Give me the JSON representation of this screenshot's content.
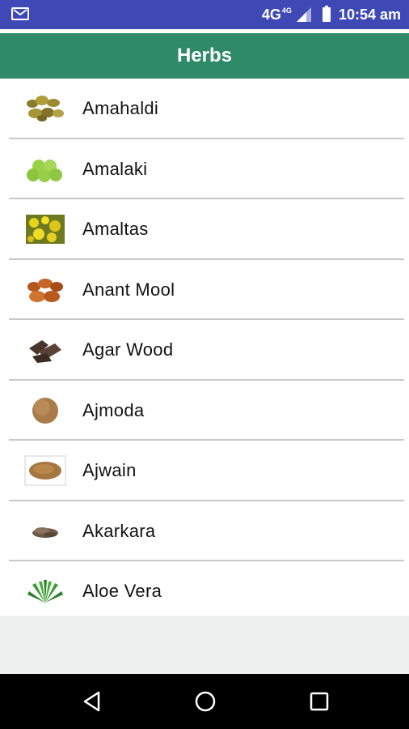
{
  "statusbar": {
    "network": "4G",
    "network_sup": "4G",
    "time": "10:54 am"
  },
  "appbar": {
    "title": "Herbs"
  },
  "herbs": [
    {
      "name": "Amahaldi",
      "icon": "amahaldi-thumbnail-icon"
    },
    {
      "name": "Amalaki",
      "icon": "amalaki-thumbnail-icon"
    },
    {
      "name": "Amaltas",
      "icon": "amaltas-thumbnail-icon"
    },
    {
      "name": "Anant Mool",
      "icon": "anant-mool-thumbnail-icon"
    },
    {
      "name": "Agar Wood",
      "icon": "agar-wood-thumbnail-icon"
    },
    {
      "name": "Ajmoda",
      "icon": "ajmoda-thumbnail-icon"
    },
    {
      "name": "Ajwain",
      "icon": "ajwain-thumbnail-icon"
    },
    {
      "name": "Akarkara",
      "icon": "akarkara-thumbnail-icon"
    },
    {
      "name": "Aloe Vera",
      "icon": "aloe-vera-thumbnail-icon"
    }
  ],
  "colors": {
    "statusbar": "#3f49b6",
    "appbar": "#2f8a68",
    "divider": "#c8c8c8",
    "navbar": "#000000"
  }
}
